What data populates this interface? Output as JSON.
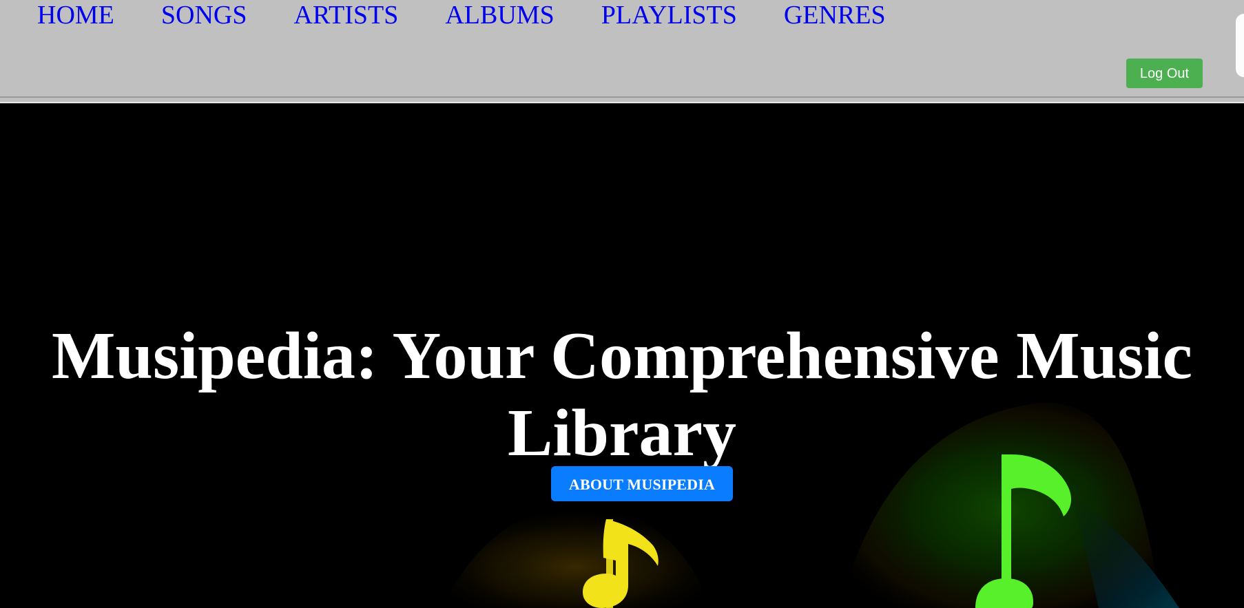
{
  "nav": {
    "items": [
      {
        "label": "HOME"
      },
      {
        "label": "SONGS"
      },
      {
        "label": "ARTISTS"
      },
      {
        "label": "ALBUMS"
      },
      {
        "label": "PLAYLISTS"
      },
      {
        "label": "GENRES"
      }
    ]
  },
  "header": {
    "logout_label": "Log Out"
  },
  "hero": {
    "title": "Musipedia: Your Comprehensive Music Library",
    "about_button_label": "ABOUT MUSIPEDIA"
  },
  "colors": {
    "nav_background": "#c0c0c0",
    "nav_link": "#0000ee",
    "logout_button": "#4caf50",
    "hero_background": "#000000",
    "hero_title": "#ffffff",
    "about_button": "#0a7cff",
    "note_yellow": "#f2e21a",
    "note_green": "#58f02a"
  },
  "icons": {
    "hero_art_left": "music-note-icon",
    "hero_art_right": "music-note-icon"
  }
}
